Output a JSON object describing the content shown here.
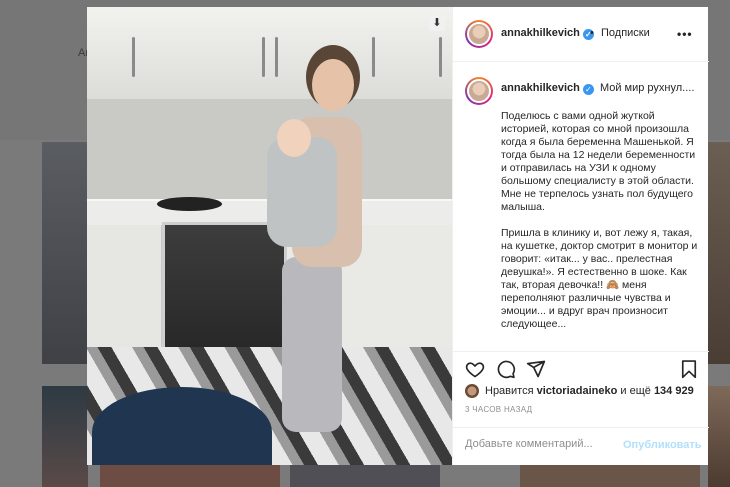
{
  "background": {
    "partial_name": "An"
  },
  "photo": {
    "download_icon": "download-icon"
  },
  "header": {
    "username": "annakhilkevich",
    "verified_icon": "verified-badge-icon",
    "separator": "•",
    "follow_label": "Подписки",
    "more_icon": "more-options-icon"
  },
  "caption": {
    "username": "annakhilkevich",
    "first_line": "Мой мир рухнул....",
    "paragraph1": "Поделюсь с вами одной жуткой историей, которая со мной произошла когда я была беременна Машенькой. Я тогда была на 12 недели беременности и отправилась на УЗИ к одному большому специалисту в этой области. Мне не терпелось узнать пол будущего малыша.",
    "paragraph2": "Пришла в клинику и, вот лежу я, такая, на кушетке, доктор смотрит в монитор и говорит: «итак... у вас.. прелестная девушка!». Я естественно в шоке. Как так, вторая девочка!! 🙈 меня переполняют различные чувства и эмоции... и вдруг врач произносит следующее..."
  },
  "actions": {
    "like_icon": "heart-icon",
    "comment_icon": "comment-icon",
    "share_icon": "share-icon",
    "save_icon": "bookmark-icon"
  },
  "likes": {
    "prefix": "Нравится",
    "user": "victoriadaineko",
    "middle": "и ещё",
    "count": "134 929"
  },
  "time_ago": "3 ЧАСОВ НАЗАД",
  "comment_form": {
    "placeholder": "Добавьте комментарий...",
    "publish_label": "Опубликовать"
  },
  "colors": {
    "accent": "#3897f0",
    "publish_disabled": "#b2dffc",
    "text": "#262626",
    "muted": "#8e8e8e"
  }
}
